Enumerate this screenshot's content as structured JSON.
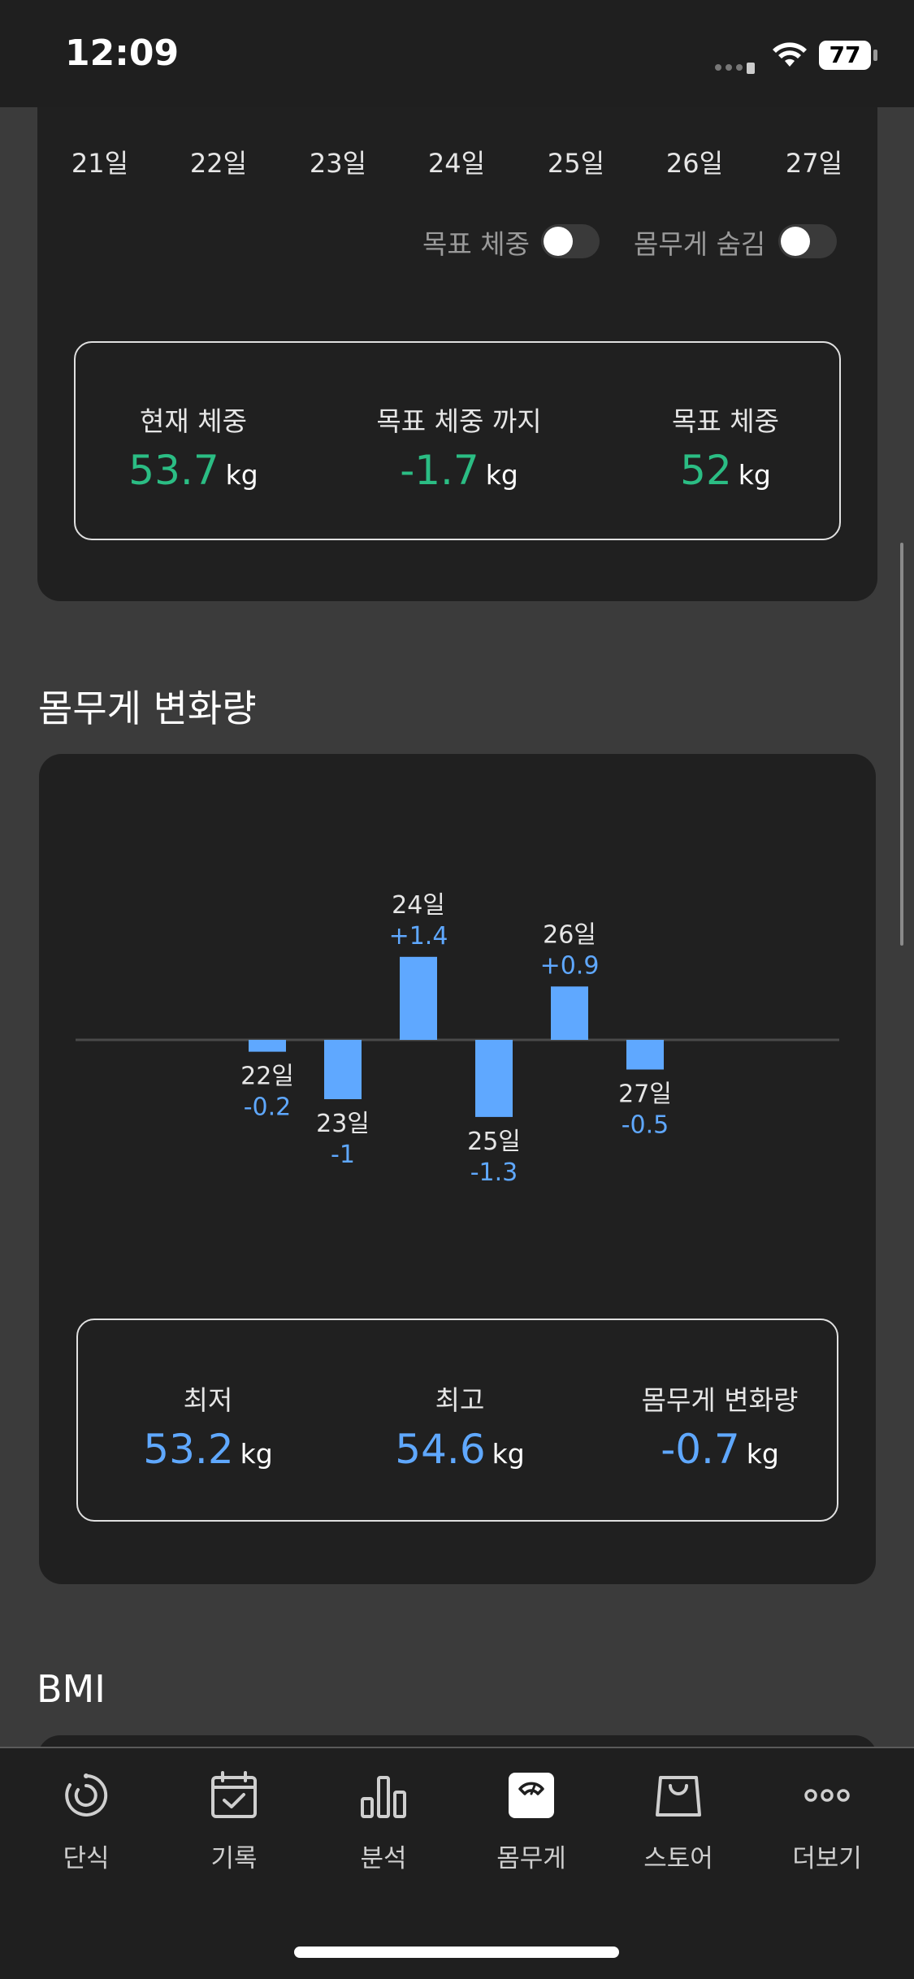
{
  "status_bar": {
    "time": "12:09",
    "battery": "77"
  },
  "top_card": {
    "dates": [
      "21일",
      "22일",
      "23일",
      "24일",
      "25일",
      "26일",
      "27일"
    ],
    "toggles": [
      {
        "label": "목표 체중",
        "on": false
      },
      {
        "label": "몸무게 숨김",
        "on": false
      }
    ],
    "stats": [
      {
        "label": "현재 체중",
        "value": "53.7",
        "unit": "kg"
      },
      {
        "label": "목표 체중 까지",
        "value": "-1.7",
        "unit": "kg"
      },
      {
        "label": "목표 체중",
        "value": "52",
        "unit": "kg"
      }
    ]
  },
  "change_section": {
    "title": "몸무게 변화량",
    "stats": [
      {
        "label": "최저",
        "value": "53.2",
        "unit": "kg"
      },
      {
        "label": "최고",
        "value": "54.6",
        "unit": "kg"
      },
      {
        "label": "몸무게 변화량",
        "value": "-0.7",
        "unit": "kg"
      }
    ]
  },
  "chart_data": {
    "type": "bar",
    "categories": [
      "22일",
      "23일",
      "24일",
      "25일",
      "26일",
      "27일"
    ],
    "values": [
      -0.2,
      -1,
      1.4,
      -1.3,
      0.9,
      -0.5
    ],
    "value_labels": [
      "-0.2",
      "-1",
      "+1.4",
      "-1.3",
      "+0.9",
      "-0.5"
    ],
    "bar_color": "#5fa8ff",
    "baseline_color": "#4a4a4a"
  },
  "bmi_section": {
    "title": "BMI"
  },
  "tab_bar": {
    "items": [
      {
        "label": "단식",
        "icon": "fasting-timer-icon",
        "active": false
      },
      {
        "label": "기록",
        "icon": "calendar-check-icon",
        "active": false
      },
      {
        "label": "분석",
        "icon": "bar-chart-icon",
        "active": false
      },
      {
        "label": "몸무게",
        "icon": "scale-icon",
        "active": true
      },
      {
        "label": "스토어",
        "icon": "shopping-bag-icon",
        "active": false
      },
      {
        "label": "더보기",
        "icon": "more-dots-icon",
        "active": false
      }
    ]
  },
  "colors": {
    "green": "#2bbd84",
    "blue": "#5fa8ff",
    "card": "#202020",
    "background": "#3b3b3b"
  }
}
